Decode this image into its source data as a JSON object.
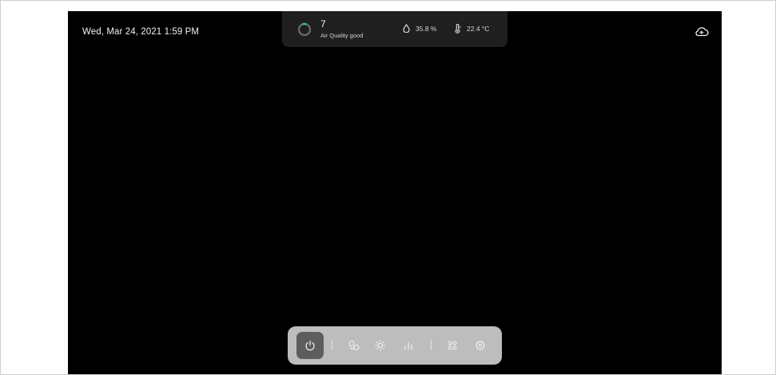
{
  "datetime": "Wed, Mar 24, 2021 1:59 PM",
  "status": {
    "air_quality_value": "7",
    "air_quality_label": "Air Quality good",
    "air_quality_icon": "air-quality-ring-icon",
    "humidity": "35.8 %",
    "humidity_icon": "water-drop-icon",
    "temperature": "22.4 °C",
    "temperature_icon": "thermometer-icon",
    "accent_color": "#2ecc71"
  },
  "top_right_icon": "cloud-connection-icon",
  "dock": {
    "items": [
      {
        "name": "power",
        "icon": "power-icon",
        "active": true
      },
      {
        "name": "fan",
        "icon": "fan-icon",
        "active": false
      },
      {
        "name": "light",
        "icon": "sun-icon",
        "active": false
      },
      {
        "name": "stats",
        "icon": "bar-chart-icon",
        "active": false
      },
      {
        "name": "apps",
        "icon": "apps-grid-icon",
        "active": false
      },
      {
        "name": "settings",
        "icon": "gear-icon",
        "active": false
      }
    ]
  },
  "colors": {
    "background": "#000000",
    "panel": "#1f1f1f",
    "dock": "#bdbdbd",
    "dock_active": "#5d5d5d"
  }
}
